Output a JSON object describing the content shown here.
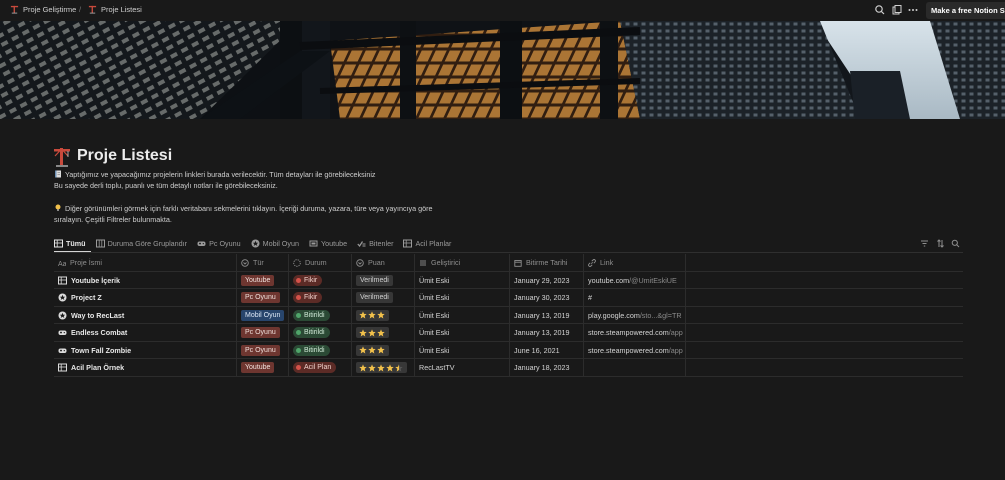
{
  "breadcrumb": {
    "parent": "Proje Geliştirme",
    "separator": "/",
    "current": "Proje Listesi"
  },
  "topbar": {
    "icons": [
      "search-icon",
      "duplicate-icon",
      "more-icon"
    ],
    "promo_label": "Make a free Notion Site"
  },
  "page": {
    "title": "Proje Listesi",
    "description_lines": [
      "Yaptığımız ve yapacağımız projelerin linkleri burada verilecektir. Tüm detayları ile görebileceksiniz",
      "Bu sayede derli toplu, puanlı ve tüm detaylı notları ile görebileceksiniz.",
      "Diğer görünümleri görmek için farklı veritabanı sekmelerini tıklayın. İçeriği duruma, yazara, türe veya yayıncıya göre",
      "sıralayın. Çeşitli Filtreler bulunmakta."
    ]
  },
  "tabs": [
    {
      "label": "Tümü",
      "icon": "table-icon",
      "active": true
    },
    {
      "label": "Duruma Göre Gruplandır",
      "icon": "board-icon",
      "active": false
    },
    {
      "label": "Pc Oyunu",
      "icon": "gamepad-icon",
      "active": false
    },
    {
      "label": "Mobil Oyun",
      "icon": "star-badge-icon",
      "active": false
    },
    {
      "label": "Youtube",
      "icon": "video-icon",
      "active": false
    },
    {
      "label": "Bitenler",
      "icon": "done-icon",
      "active": false
    },
    {
      "label": "Acil Planlar",
      "icon": "table-icon",
      "active": false
    }
  ],
  "table": {
    "headers": {
      "name": "Proje İsmi",
      "tur": "Tür",
      "durum": "Durum",
      "puan": "Puan",
      "gelistirici": "Geliştirici",
      "bitirme": "Bitirme Tarihi",
      "link": "Link"
    },
    "rows": [
      {
        "name": "Youtube İçerik",
        "icon": "table-icon",
        "tur": "Youtube",
        "tur_kind": "youtube",
        "durum": "Fikir",
        "durum_color": "red",
        "puan_text": "Verilmedi",
        "stars": 0,
        "gelistirici": "Ümit Eski",
        "bitirme": "January 29, 2023",
        "link_main": "youtube.com",
        "link_rest": "/@UmitEskiUE"
      },
      {
        "name": "Project Z",
        "icon": "star-badge-icon",
        "tur": "Pc Oyunu",
        "tur_kind": "pc",
        "durum": "Fikir",
        "durum_color": "red",
        "puan_text": "Verilmedi",
        "stars": 0,
        "gelistirici": "Ümit Eski",
        "bitirme": "January 30, 2023",
        "link_main": "#",
        "link_rest": ""
      },
      {
        "name": "Way to RecLast",
        "icon": "star-badge-icon",
        "tur": "Mobil Oyun",
        "tur_kind": "mobil",
        "durum": "Bitirildi",
        "durum_color": "green",
        "puan_text": "",
        "stars": 3,
        "gelistirici": "Ümit Eski",
        "bitirme": "January 13, 2019",
        "link_main": "play.google.com",
        "link_rest": "/sto...&gl=TR"
      },
      {
        "name": "Endless Combat",
        "icon": "gamepad-icon",
        "tur": "Pc Oyunu",
        "tur_kind": "pc",
        "durum": "Bitirildi",
        "durum_color": "green",
        "puan_text": "",
        "stars": 3,
        "gelistirici": "Ümit Eski",
        "bitirme": "January 13, 2019",
        "link_main": "store.steampowered.com",
        "link_rest": "/app"
      },
      {
        "name": "Town Fall Zombie",
        "icon": "gamepad-icon",
        "tur": "Pc Oyunu",
        "tur_kind": "pc",
        "durum": "Bitirildi",
        "durum_color": "green",
        "puan_text": "",
        "stars": 3,
        "gelistirici": "Ümit Eski",
        "bitirme": "June 16, 2021",
        "link_main": "store.steampowered.com",
        "link_rest": "/app"
      },
      {
        "name": "Acil Plan Örnek",
        "icon": "table-icon",
        "tur": "Youtube",
        "tur_kind": "youtube",
        "durum": "Acil Plan",
        "durum_color": "red",
        "puan_text": "",
        "stars": 4.5,
        "gelistirici": "RecLastTV",
        "bitirme": "January 18, 2023",
        "link_main": "",
        "link_rest": ""
      }
    ]
  },
  "colors": {
    "background": "#191919",
    "tag_red": "#6e3630",
    "tag_blue": "#28456c",
    "status_red": "#d5524a",
    "status_green": "#50a56a",
    "star": "#f2c14b"
  }
}
